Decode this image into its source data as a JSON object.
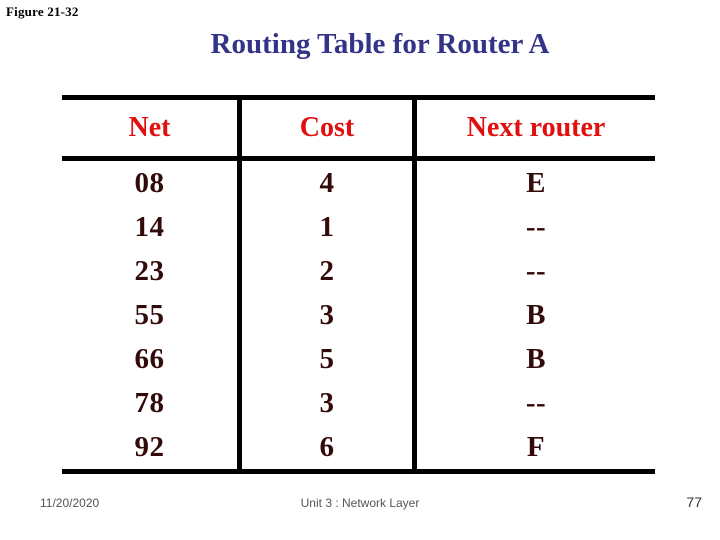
{
  "figure": {
    "label": "Figure 21-32"
  },
  "title": {
    "text": "Routing Table for Router A"
  },
  "colors": {
    "title_blue": "#333388",
    "header_red": "#e01010",
    "data_maroon": "#330a0a",
    "border_black": "#000000",
    "background": "#ffffff"
  },
  "table": {
    "headers": [
      "Net",
      "Cost",
      "Next router"
    ],
    "rows": [
      {
        "net": "08",
        "cost": "4",
        "next_router": "E"
      },
      {
        "net": "14",
        "cost": "1",
        "next_router": "--"
      },
      {
        "net": "23",
        "cost": "2",
        "next_router": "--"
      },
      {
        "net": "55",
        "cost": "3",
        "next_router": "B"
      },
      {
        "net": "66",
        "cost": "5",
        "next_router": "B"
      },
      {
        "net": "78",
        "cost": "3",
        "next_router": "--"
      },
      {
        "net": "92",
        "cost": "6",
        "next_router": "F"
      }
    ]
  },
  "footer": {
    "date": "11/20/2020",
    "center": "Unit 3 : Network Layer",
    "page": "77"
  }
}
